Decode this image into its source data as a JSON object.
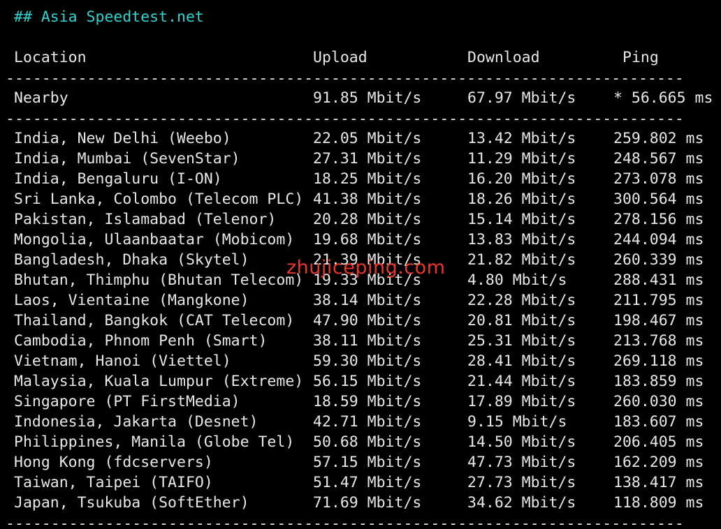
{
  "heading": "## Asia Speedtest.net",
  "columns": {
    "location": "Location",
    "upload": "Upload",
    "download": "Download",
    "ping": "Ping"
  },
  "separator": "--------------------------------------------------------------------------------",
  "nearby": {
    "location": "Nearby",
    "upload": "91.85 Mbit/s",
    "download": "67.97 Mbit/s",
    "ping": "* 56.665 ms"
  },
  "rows": [
    {
      "location": "India, New Delhi (Weebo)",
      "upload": "22.05 Mbit/s",
      "download": "13.42 Mbit/s",
      "ping": "259.802 ms"
    },
    {
      "location": "India, Mumbai (SevenStar)",
      "upload": "27.31 Mbit/s",
      "download": "11.29 Mbit/s",
      "ping": "248.567 ms"
    },
    {
      "location": "India, Bengaluru (I-ON)",
      "upload": "18.25 Mbit/s",
      "download": "16.20 Mbit/s",
      "ping": "273.078 ms"
    },
    {
      "location": "Sri Lanka, Colombo (Telecom PLC)",
      "upload": "41.38 Mbit/s",
      "download": "18.26 Mbit/s",
      "ping": "300.564 ms"
    },
    {
      "location": "Pakistan, Islamabad (Telenor)",
      "upload": "20.28 Mbit/s",
      "download": "15.14 Mbit/s",
      "ping": "278.156 ms"
    },
    {
      "location": "Mongolia, Ulaanbaatar (Mobicom)",
      "upload": "19.68 Mbit/s",
      "download": "13.83 Mbit/s",
      "ping": "244.094 ms"
    },
    {
      "location": "Bangladesh, Dhaka (Skytel)",
      "upload": "21.39 Mbit/s",
      "download": "21.82 Mbit/s",
      "ping": "260.339 ms"
    },
    {
      "location": "Bhutan, Thimphu (Bhutan Telecom)",
      "upload": "19.33 Mbit/s",
      "download": "4.80 Mbit/s",
      "ping": "288.431 ms"
    },
    {
      "location": "Laos, Vientaine (Mangkone)",
      "upload": "38.14 Mbit/s",
      "download": "22.28 Mbit/s",
      "ping": "211.795 ms"
    },
    {
      "location": "Thailand, Bangkok (CAT Telecom)",
      "upload": "47.90 Mbit/s",
      "download": "20.81 Mbit/s",
      "ping": "198.467 ms"
    },
    {
      "location": "Cambodia, Phnom Penh (Smart)",
      "upload": "38.11 Mbit/s",
      "download": "25.31 Mbit/s",
      "ping": "213.768 ms"
    },
    {
      "location": "Vietnam, Hanoi (Viettel)",
      "upload": "59.30 Mbit/s",
      "download": "28.41 Mbit/s",
      "ping": "269.118 ms"
    },
    {
      "location": "Malaysia, Kuala Lumpur (Extreme)",
      "upload": "56.15 Mbit/s",
      "download": "21.44 Mbit/s",
      "ping": "183.859 ms"
    },
    {
      "location": "Singapore (PT FirstMedia)",
      "upload": "18.59 Mbit/s",
      "download": "17.89 Mbit/s",
      "ping": "260.030 ms"
    },
    {
      "location": "Indonesia, Jakarta (Desnet)",
      "upload": "42.71 Mbit/s",
      "download": "9.15 Mbit/s",
      "ping": "183.607 ms"
    },
    {
      "location": "Philippines, Manila (Globe Tel)",
      "upload": "50.68 Mbit/s",
      "download": "14.50 Mbit/s",
      "ping": "206.405 ms"
    },
    {
      "location": "Hong Kong (fdcservers)",
      "upload": "57.15 Mbit/s",
      "download": "47.73 Mbit/s",
      "ping": "162.209 ms"
    },
    {
      "location": "Taiwan, Taipei (TAIFO)",
      "upload": "51.47 Mbit/s",
      "download": "27.73 Mbit/s",
      "ping": "138.417 ms"
    },
    {
      "location": "Japan, Tsukuba (SoftEther)",
      "upload": "71.69 Mbit/s",
      "download": "34.62 Mbit/s",
      "ping": "118.809 ms"
    }
  ],
  "watermark": "zhujiceping.com",
  "colors": {
    "background": "#000000",
    "text": "#e8e8e8",
    "heading": "#2fd3d0",
    "watermark": "#e8362a"
  }
}
